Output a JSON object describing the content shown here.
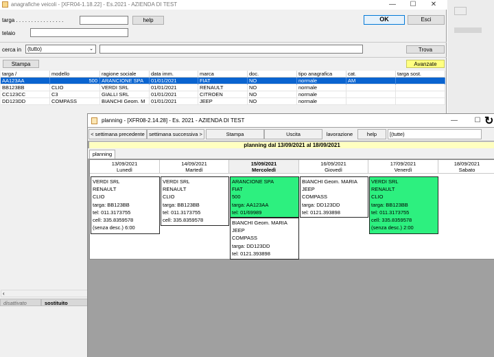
{
  "veicoli": {
    "title": "anagrafiche veicoli - [XFR04-1.18.22] - Es.2021 - AZIENDA DI TEST",
    "targa_label": "targa . . . . . . . . . . . . . . . .",
    "targa_value": "",
    "help_label": "help",
    "ok_label": "OK",
    "esci_label": "Esci",
    "telaio_label": "telaio",
    "telaio_value": "",
    "cerca_in_label": "cerca in",
    "cerca_in_selected": "(tutto)",
    "cerca_value": "",
    "trova_label": "Trova",
    "stampa_label": "Stampa",
    "avanzate_label": "Avanzate",
    "columns": [
      "targa /",
      "modello",
      "ragione sociale",
      "data imm.",
      "marca",
      "doc.",
      "tipo anagrafica",
      "cat.",
      "targa sost."
    ],
    "rows": [
      [
        "AA123AA",
        "500",
        "ARANCIONE SPA",
        "01/01/2021",
        "FIAT",
        "NO",
        "normale",
        "AM",
        ""
      ],
      [
        "BB123BB",
        "CLIO",
        "VERDI SRL",
        "01/01/2021",
        "RENAULT",
        "NO",
        "normale",
        "",
        ""
      ],
      [
        "CC123CC",
        "C3",
        "GIALLI SRL",
        "01/01/2021",
        "CITROEN",
        "NO",
        "normale",
        "",
        ""
      ],
      [
        "DD123DD",
        "COMPASS",
        "BIANCHI Geom. M",
        "01/01/2021",
        "JEEP",
        "NO",
        "normale",
        "",
        ""
      ]
    ],
    "status_disattivato": "disattivato",
    "status_sostituito": "sostituito"
  },
  "planning": {
    "title": "planning - [XFR08-2.14.28] - Es. 2021 - AZIENDA DI TEST",
    "prev_week_label": "< settimana precedente",
    "next_week_label": "settimana successiva >",
    "stampa_label": "Stampa",
    "uscita_label": "Uscita",
    "lavorazione_label": "lavorazione",
    "help_label": "help",
    "lavorazione_value": "[(tutte)",
    "period_label": "planning dal 13/09/2021 al 18/09/2021",
    "tab_label": "planning",
    "days": [
      {
        "date": "13/09/2021",
        "name": "Lunedì"
      },
      {
        "date": "14/09/2021",
        "name": "Martedì"
      },
      {
        "date": "15/09/2021",
        "name": "Mercoledì"
      },
      {
        "date": "16/09/2021",
        "name": "Giovedì"
      },
      {
        "date": "17/09/2021",
        "name": "Venerdì"
      },
      {
        "date": "18/09/2021",
        "name": "Sabato"
      }
    ],
    "appointments": [
      {
        "lines": [
          "VERDI SRL",
          "RENAULT",
          "CLIO",
          "targa: BB123BB",
          "tel: 011.3173755",
          "cell: 335.8359578",
          "(senza desc.) 6:00"
        ]
      },
      {
        "lines": [
          "VERDI SRL",
          "RENAULT",
          "CLIO",
          "targa: BB123BB",
          "tel: 011.3173755",
          "cell: 335.8359578"
        ]
      },
      {
        "lines": [
          "ARANCIONE SPA",
          "FIAT",
          "500",
          "targa: AA123AA",
          "tel: 01/69989"
        ]
      },
      {
        "lines": [
          "BIANCHI Geom. MARIA",
          "JEEP",
          "COMPASS",
          "targa: DD123DD",
          "tel: 0121.393898"
        ]
      },
      {
        "lines": [
          "BIANCHI Geom. MARIA",
          "JEEP",
          "COMPASS",
          "targa: DD123DD",
          "tel: 0121.393898"
        ]
      },
      {
        "lines": [
          "VERDI SRL",
          "RENAULT",
          "CLIO",
          "targa: BB123BB",
          "tel: 011.3173755",
          "cell: 335.8359578",
          "(senza desc.) 2:00"
        ]
      }
    ]
  },
  "window_controls": {
    "minimize": "—",
    "maximize": "☐",
    "close": "✕"
  },
  "colors": {
    "selection": "#0a64d0",
    "highlight_yellow": "#ffff80",
    "appointment_green": "#2df07f",
    "period_bar": "#ffffc0"
  }
}
